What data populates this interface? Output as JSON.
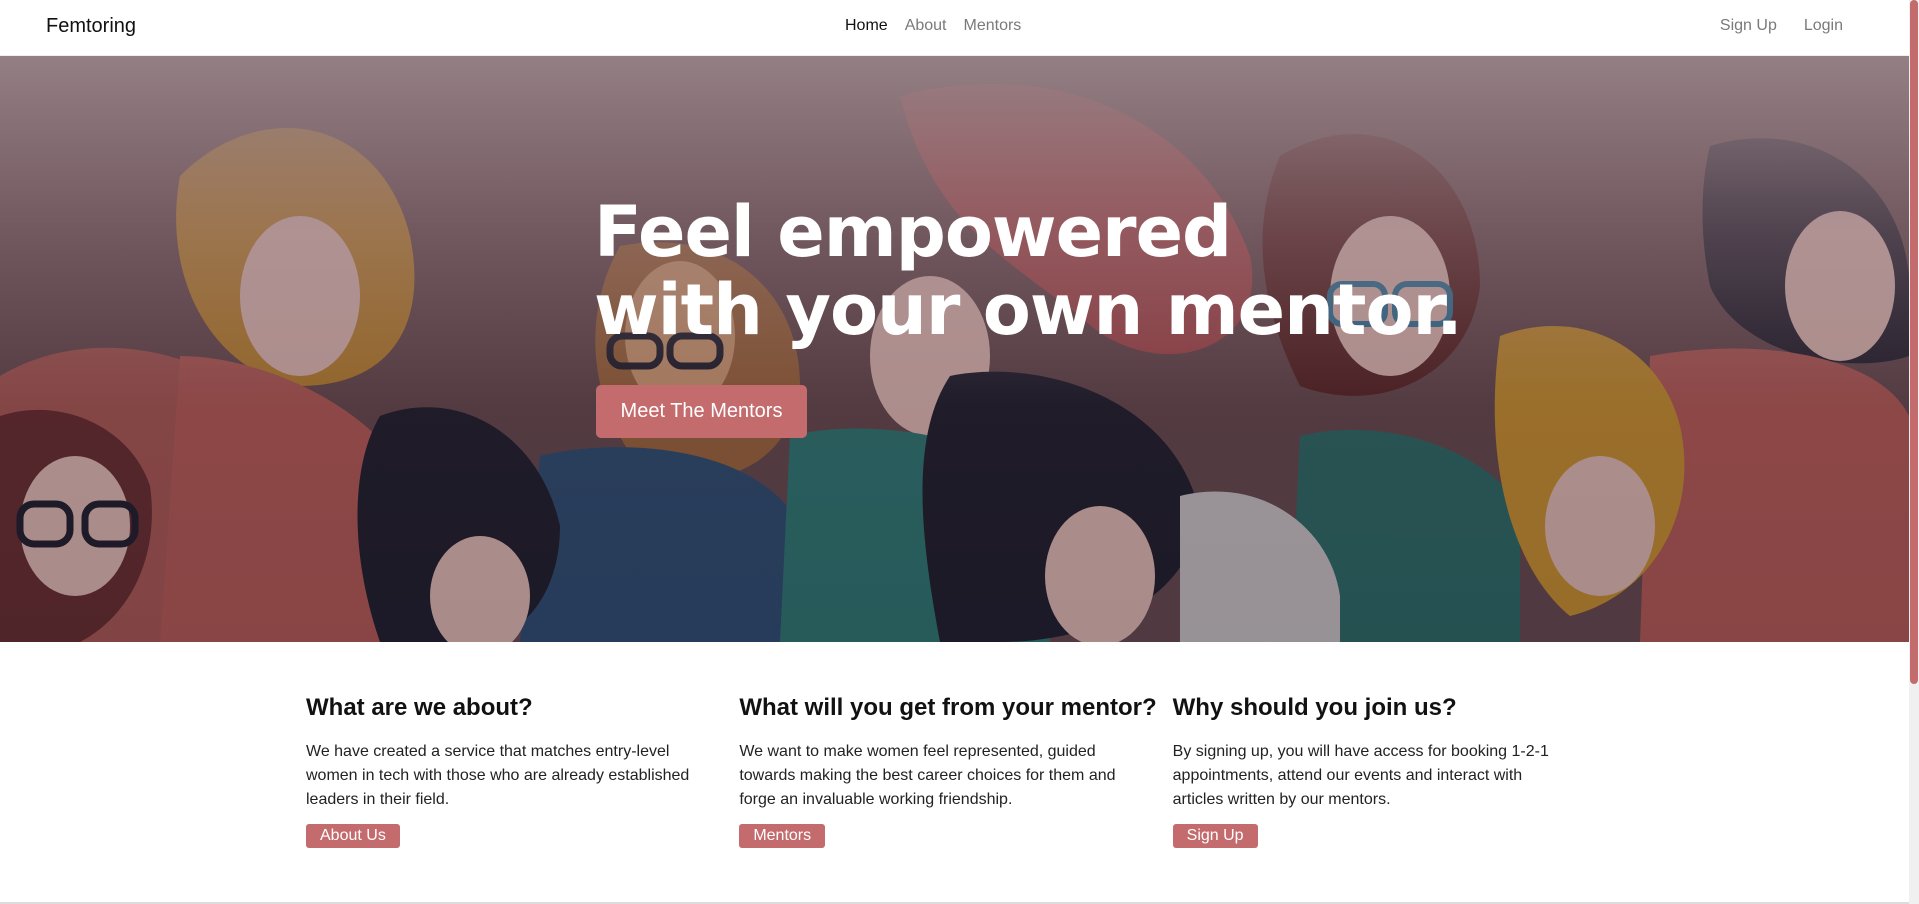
{
  "navbar": {
    "brand": "Femtoring",
    "links": [
      "Home",
      "About",
      "Mentors"
    ],
    "auth": [
      "Sign Up",
      "Login"
    ]
  },
  "hero": {
    "line1": "Feel empowered",
    "line2": "with your own mentor.",
    "button": "Meet The Mentors"
  },
  "features": [
    {
      "title": "What are we about?",
      "text": "We have created a service that matches entry-level women in tech with those who are already established leaders in their field.",
      "button": "About Us"
    },
    {
      "title": "What will you get from your mentor?",
      "text": "We want to make women feel represented, guided towards making the best career choices for them and forge an invaluable working friendship.",
      "button": "Mentors"
    },
    {
      "title": "Why should you join us?",
      "text": "By signing up, you will have access for booking 1-2-1 appointments, attend our events and interact with articles written by our mentors.",
      "button": "Sign Up"
    }
  ],
  "colors": {
    "accent": "#c46b6e"
  }
}
